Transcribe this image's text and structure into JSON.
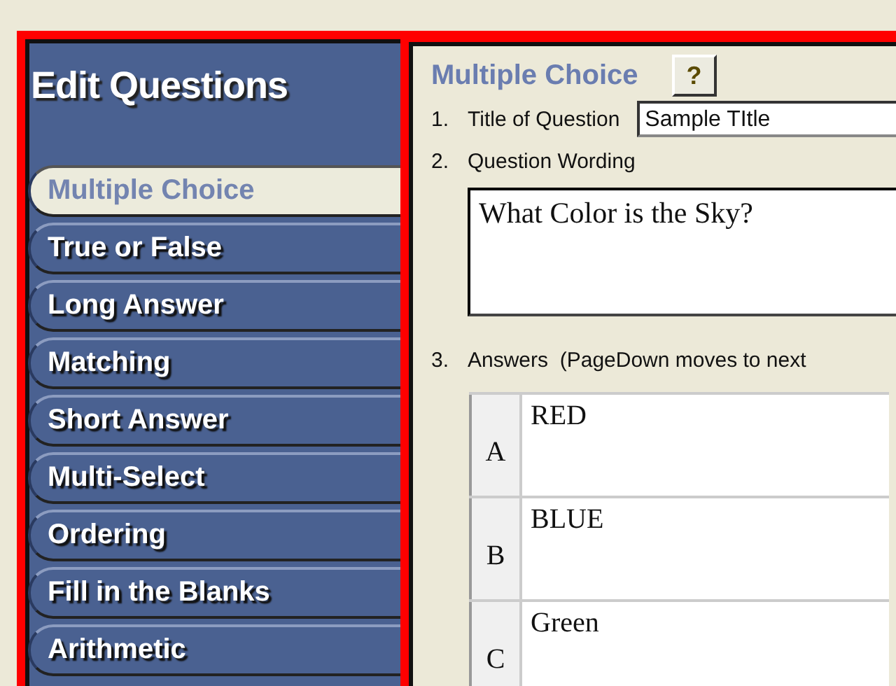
{
  "sidebar": {
    "title": "Edit Questions",
    "items": [
      {
        "label": "Multiple Choice",
        "selected": true
      },
      {
        "label": "True or False",
        "selected": false
      },
      {
        "label": "Long Answer",
        "selected": false
      },
      {
        "label": "Matching",
        "selected": false
      },
      {
        "label": "Short Answer",
        "selected": false
      },
      {
        "label": "Multi-Select",
        "selected": false
      },
      {
        "label": "Ordering",
        "selected": false
      },
      {
        "label": "Fill in the Blanks",
        "selected": false
      },
      {
        "label": "Arithmetic",
        "selected": false
      }
    ]
  },
  "editor": {
    "heading": "Multiple Choice",
    "help_button": "?",
    "title_of_question": {
      "number": "1.",
      "label": "Title of Question",
      "value": "Sample TItle"
    },
    "question_wording": {
      "number": "2.",
      "label": "Question Wording",
      "value": "What Color is the Sky?"
    },
    "answers": {
      "number": "3.",
      "label": "Answers  (PageDown moves to next",
      "rows": [
        {
          "letter": "A",
          "text": "RED"
        },
        {
          "letter": "B",
          "text": "BLUE"
        },
        {
          "letter": "C",
          "text": "Green"
        }
      ]
    }
  }
}
